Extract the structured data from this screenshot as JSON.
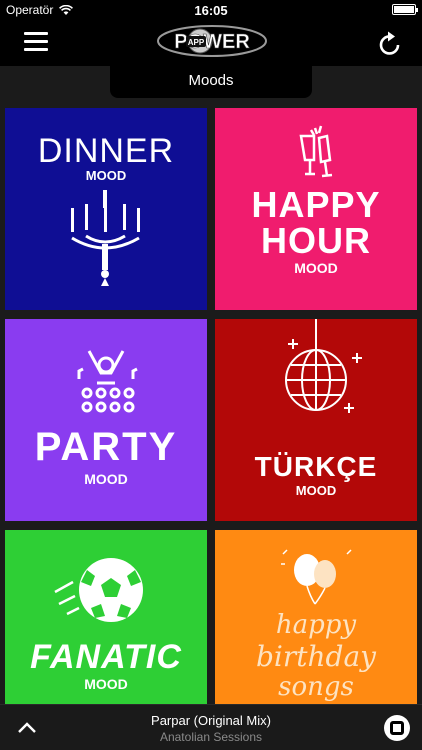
{
  "status_bar": {
    "carrier": "Operatör",
    "time": "16:05"
  },
  "header": {
    "logo_text": "POWER",
    "logo_badge": "APP"
  },
  "page_tab": "Moods",
  "tiles": [
    {
      "title": "DINNER",
      "subtitle": "MOOD",
      "color": "#0f0e94"
    },
    {
      "title_line1": "HAPPY",
      "title_line2": "HOUR",
      "subtitle": "MOOD",
      "color": "#f01c6e"
    },
    {
      "title": "PARTY",
      "subtitle": "MOOD",
      "color": "#8a3cf0"
    },
    {
      "title": "TÜRKÇE",
      "subtitle": "MOOD",
      "color": "#b30808"
    },
    {
      "title": "FANATIC",
      "subtitle": "MOOD",
      "color": "#2ecf35"
    },
    {
      "line1": "happy",
      "line2": "birthday",
      "line3": "songs",
      "color": "#ff8a12"
    }
  ],
  "player": {
    "track": "Parpar (Original Mix)",
    "artist": "Anatolian Sessions"
  }
}
